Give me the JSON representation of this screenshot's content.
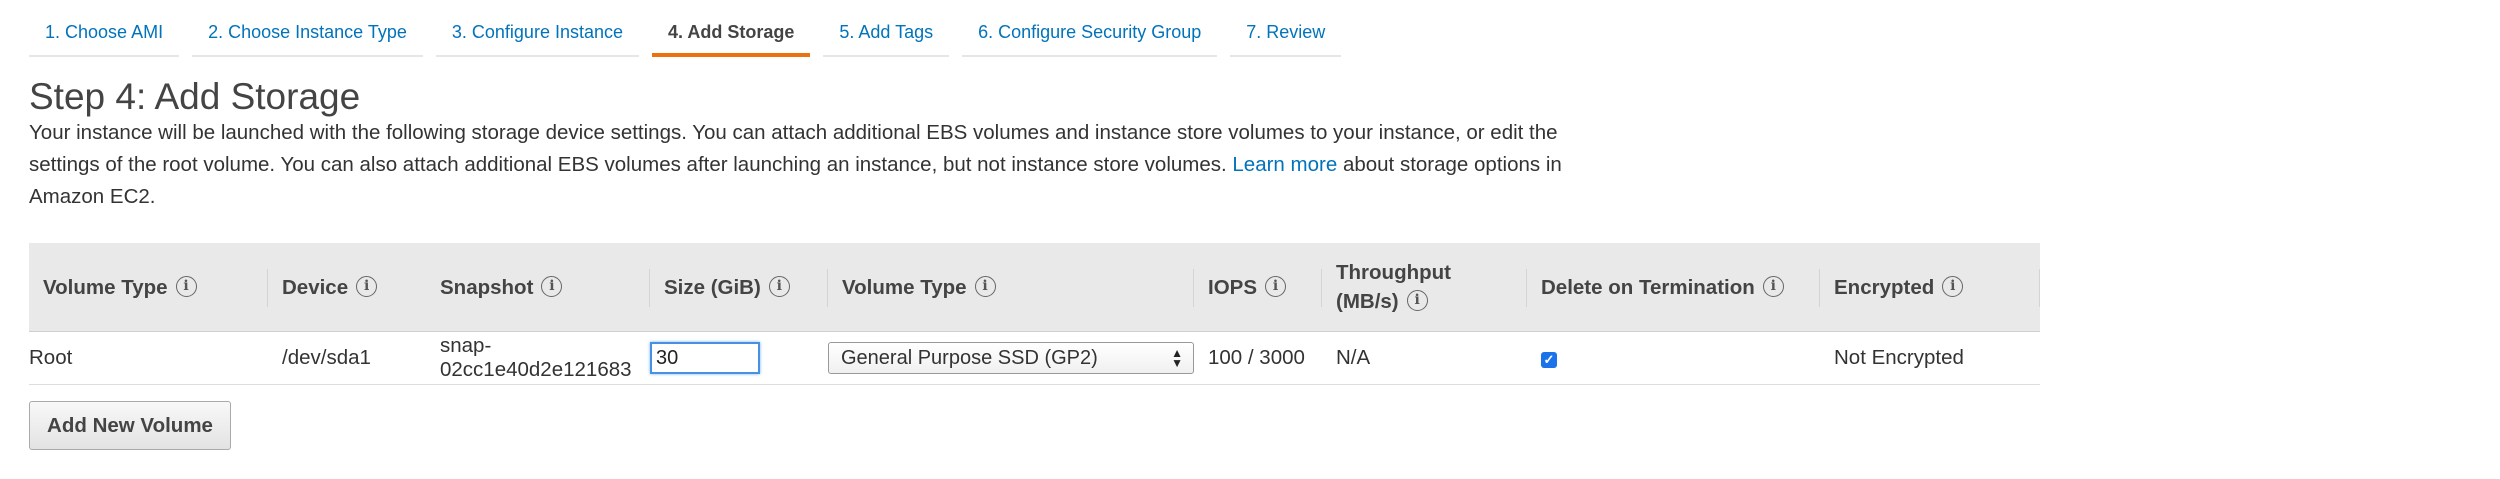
{
  "wizard": {
    "tabs": [
      {
        "label": "1. Choose AMI"
      },
      {
        "label": "2. Choose Instance Type"
      },
      {
        "label": "3. Configure Instance"
      },
      {
        "label": "4. Add Storage",
        "active": true
      },
      {
        "label": "5. Add Tags"
      },
      {
        "label": "6. Configure Security Group"
      },
      {
        "label": "7. Review"
      }
    ]
  },
  "page": {
    "title": "Step 4: Add Storage",
    "description_before": "Your instance will be launched with the following storage device settings. You can attach additional EBS volumes and instance store volumes to your instance, or edit the settings of the root volume. You can also attach additional EBS volumes after launching an instance, but not instance store volumes.",
    "learn_more": "Learn more",
    "description_after": "about storage options in Amazon EC2."
  },
  "table": {
    "headers": {
      "volume_type": "Volume Type",
      "device": "Device",
      "snapshot": "Snapshot",
      "size": "Size (GiB)",
      "ebs_volume_type": "Volume Type",
      "iops": "IOPS",
      "throughput_line1": "Throughput",
      "throughput_line2": "(MB/s)",
      "delete_on_termination": "Delete on Termination",
      "encrypted": "Encrypted"
    },
    "rows": [
      {
        "volume_type": "Root",
        "device": "/dev/sda1",
        "snapshot_line1": "snap-",
        "snapshot_line2": "02cc1e40d2e121683",
        "size": "30",
        "ebs_volume_type": "General Purpose SSD (GP2)",
        "iops": "100 / 3000",
        "throughput": "N/A",
        "delete_on_termination": true,
        "encrypted": "Not Encrypted"
      }
    ]
  },
  "buttons": {
    "add_new_volume": "Add New Volume"
  },
  "icons": {
    "info": "i",
    "checkmark": "✓",
    "select_arrows_up": "▲",
    "select_arrows_down": "▼"
  },
  "colors": {
    "link": "#0073bb",
    "active_tab_underline": "#ec7211",
    "header_bg": "#e9e9e9",
    "checkbox": "#1a73e8"
  }
}
